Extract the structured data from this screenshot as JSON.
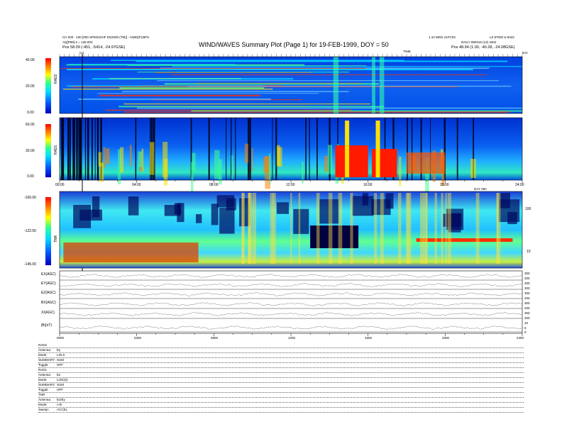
{
  "header": {
    "left_line1": "CH 000 - 100 [000 SPIKES/HF DS2000 (TM)] - AWID[F]-BPS",
    "left_line2": "AQ[P89]-2 = 135.00C",
    "left_pos_label": "Pos",
    "left_pos_value": "58.09 (-451, -5414, -24.97GSE)",
    "title": "WIND/WAVES Summary Plot (Page 1) for 19-FEB-1999, DOY = 50",
    "right_line1": "1.10 WED 21FC03",
    "right_line1b": "LZ 87000 w 9422",
    "right_line2": "DAILY 990319 (13) 3402",
    "right_pos_label": "Pos",
    "right_pos_value": "48.94 (1.00, -40.28, -24.08GSE)",
    "ticks_label": "TIME",
    "c_marker": "Cd",
    "khz_label": "kHz"
  },
  "chart_data": [
    {
      "type": "heatmap",
      "name_label": "RAD2",
      "ylim": [
        0,
        40
      ],
      "ytick_labels": [
        "40.00",
        "20.00",
        "0.00"
      ]
    },
    {
      "type": "heatmap",
      "name_label": "RAD1",
      "ylim": [
        0,
        60
      ],
      "ytick_labels": [
        "60.00",
        "30.00",
        "0.00"
      ],
      "x_tick_labels": [
        "00:00",
        "04:00",
        "08:00",
        "12:00",
        "16:00",
        "20:00",
        "24:00"
      ],
      "x_corner_label": "DAY 050"
    },
    {
      "type": "heatmap",
      "name_label": "TNR",
      "ylim": [
        -145,
        -100
      ],
      "ytick_labels": [
        "-100.00",
        "-122.50",
        "-145.00"
      ],
      "right_tick_labels": [
        "100",
        "10"
      ]
    },
    {
      "type": "line",
      "x_tick_labels": [
        "0000",
        "0400",
        "0800",
        "1200",
        "1600",
        "2000",
        "2400"
      ],
      "series": [
        {
          "name": "EX(AGC)",
          "right_ticks": [
            "300",
            "200"
          ]
        },
        {
          "name": "EY(AGC)",
          "right_ticks": [
            "300",
            "200"
          ]
        },
        {
          "name": "EZ(AGC)",
          "right_ticks": [
            "300",
            "200"
          ]
        },
        {
          "name": "BX(AGC)",
          "right_ticks": [
            "300",
            "200"
          ]
        },
        {
          "name": "XI(AGC)",
          "right_ticks": [
            "300",
            "200"
          ]
        },
        {
          "name": "|B|(nT)",
          "right_ticks": [
            "10",
            "5",
            "0"
          ]
        }
      ]
    }
  ],
  "bottom_info": {
    "rad2": [
      {
        "k": "RAD2",
        "v": ""
      },
      {
        "k": "Antenna:",
        "v": "Ey"
      },
      {
        "k": "Mode:",
        "v": "LIN S"
      },
      {
        "k": "SUMMARY:",
        "v": "SUM"
      },
      {
        "k": "Toggle:",
        "v": "OFF"
      }
    ],
    "rad1": [
      {
        "k": "RAD1",
        "v": ""
      },
      {
        "k": "Antenna:",
        "v": "Ex"
      },
      {
        "k": "Mode:",
        "v": "LOG(S)"
      },
      {
        "k": "SUMMARY:",
        "v": "SUM"
      },
      {
        "k": "Toggle:",
        "v": "OFF"
      }
    ],
    "tnr": [
      {
        "k": "TNR",
        "v": ""
      },
      {
        "k": "Antenna:",
        "v": "Ex/Ey"
      },
      {
        "k": "Mode:",
        "v": "A B"
      },
      {
        "k": "Sweep:",
        "v": "ACCEL"
      }
    ]
  },
  "colors": {
    "background": "#ffffff",
    "spectrum_low": "#0000a0",
    "spectrum_mid": "#00c8ff",
    "spectrum_high": "#ff0000"
  }
}
